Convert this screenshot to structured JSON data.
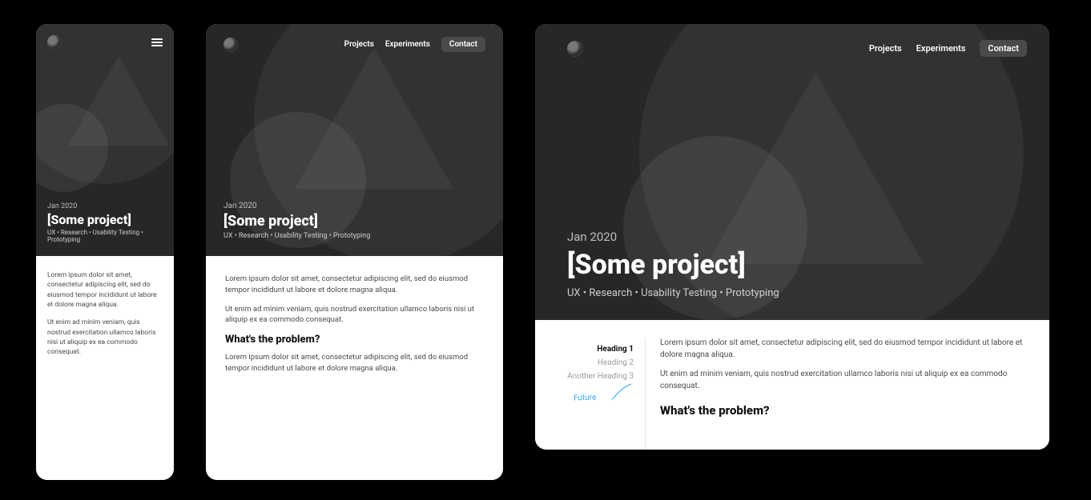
{
  "nav": {
    "projects": "Projects",
    "experiments": "Experiments",
    "contact": "Contact"
  },
  "hero": {
    "date": "Jan 2020",
    "title": "[Some project]",
    "tags": "UX • Research • Usability Testing • Prototyping"
  },
  "body": {
    "p1": "Lorem ipsum dolor sit amet, consectetur adipiscing elit, sed do eiusmod tempor incididunt ut labore et dolore magna aliqua.",
    "p2": "Ut enim ad minim veniam, quis nostrud exercitation ullamco laboris nisi ut aliquip ex ea commodo consequat.",
    "subheading": "What's the problem?",
    "p3": "Lorem ipsum dolor sit amet, consectetur adipiscing elit, sed do eiusmod tempor incididunt ut labore et dolore magna aliqua."
  },
  "toc": {
    "items": [
      "Heading 1",
      "Heading 2",
      "Another Heading 3"
    ],
    "future_label": "Future"
  }
}
